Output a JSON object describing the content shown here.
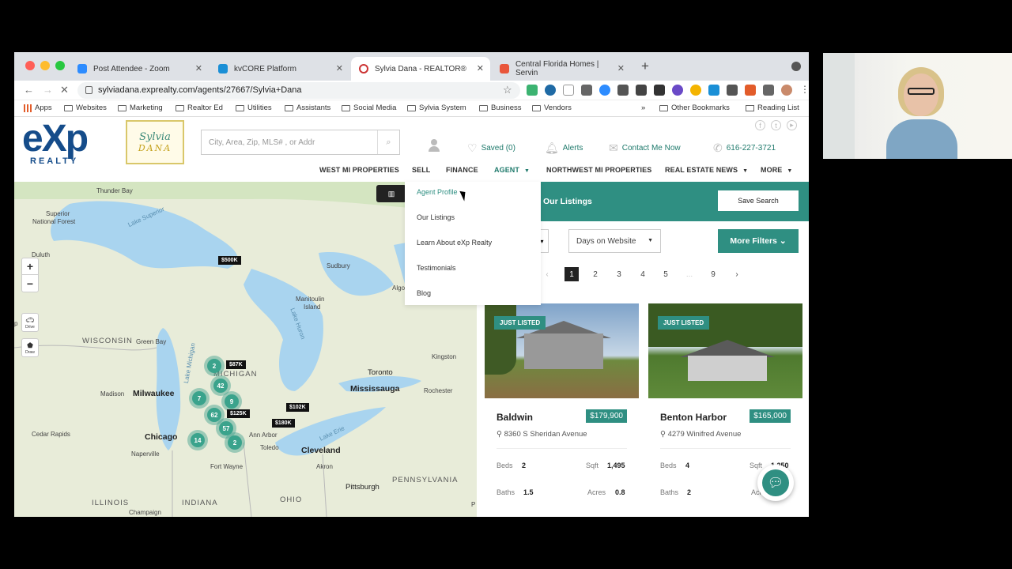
{
  "browser": {
    "tabs": [
      {
        "title": "Post Attendee - Zoom",
        "active": false
      },
      {
        "title": "kvCORE Platform",
        "active": false
      },
      {
        "title": "Sylvia Dana - REALTOR®",
        "active": true
      },
      {
        "title": "Central Florida Homes | Servin",
        "active": false
      }
    ],
    "url": "sylviadana.exprealty.com/agents/27667/Sylvia+Dana",
    "bookmarks": [
      "Apps",
      "Websites",
      "Marketing",
      "Realtor Ed",
      "Utilities",
      "Assistants",
      "Social Media",
      "Sylvia System",
      "Business",
      "Vendors"
    ],
    "other_bookmarks": "Other Bookmarks",
    "reading_list": "Reading List",
    "more_bookmarks": "»"
  },
  "header": {
    "exp_logo_big": "eXp",
    "exp_logo_small": "REALTY",
    "dana_logo_line1": "Sylvia",
    "dana_logo_line2": "DANA",
    "search_placeholder": "City, Area, Zip, MLS# , or Addr",
    "saved": "Saved (0)",
    "alerts": "Alerts",
    "contact": "Contact Me Now",
    "phone": "616-227-3721"
  },
  "nav": {
    "items": [
      "WEST MI PROPERTIES",
      "SELL",
      "FINANCE",
      "AGENT",
      "NORTHWEST MI PROPERTIES",
      "REAL ESTATE NEWS",
      "MORE"
    ]
  },
  "agent_menu": {
    "items": [
      "Agent Profile",
      "Our Listings",
      "Learn About eXp Realty",
      "Testimonials",
      "Blog"
    ]
  },
  "listings_panel": {
    "title_suffix": "r Our Listings",
    "save_search": "Save Search",
    "stub_select_caret": "▾",
    "sort_select": "Days on Website",
    "more_filters": "More Filters",
    "pages": [
      "‹",
      "1",
      "2",
      "3",
      "4",
      "5",
      "...",
      "9",
      "›"
    ],
    "active_page": "1"
  },
  "map": {
    "zoom_in": "+",
    "zoom_out": "−",
    "drive": "Drive",
    "draw": "Draw",
    "labels": {
      "thunder_bay": "Thunder Bay",
      "superior_nf": "Superior",
      "superior_nf2": "National Forest",
      "lake_superior": "Lake Superior",
      "duluth": "Duluth",
      "sudbury": "Sudbury",
      "manitoulin": "Manitoulin",
      "manitoulin2": "Island",
      "algo": "Algo",
      "wisconsin": "WISCONSIN",
      "green_bay": "Green Bay",
      "lake_michigan": "Lake Michigan",
      "lake_huron": "Lake Huron",
      "michigan": "MICHIGAN",
      "toronto": "Toronto",
      "kingston": "Kingston",
      "mississauga": "Mississauga",
      "rochester": "Rochester",
      "madison": "Madison",
      "milwaukee": "Milwaukee",
      "cedar_rapids": "Cedar Rapids",
      "chicago": "Chicago",
      "naperville": "Naperville",
      "ann_arbor": "Ann Arbor",
      "toledo": "Toledo",
      "cleveland": "Cleveland",
      "lake_erie": "Lake Erie",
      "akron": "Akron",
      "fort_wayne": "Fort Wayne",
      "pittsburgh": "Pittsburgh",
      "pennsylvania": "PENNSYLVANIA",
      "illinois": "ILLINOIS",
      "indiana": "INDIANA",
      "ohio": "OHIO",
      "champaign": "Champaign",
      "west_edge": "p",
      "south_edge": "P"
    },
    "clusters": [
      "2",
      "42",
      "7",
      "9",
      "62",
      "57",
      "14",
      "2"
    ],
    "price_tags": [
      "$500K",
      "$87K",
      "$125K",
      "$102K",
      "$180K"
    ]
  },
  "listings": [
    {
      "badge": "JUST LISTED",
      "city": "Baldwin",
      "price": "$179,900",
      "address": "8360 S Sheridan Avenue",
      "beds": "2",
      "sqft": "1,495",
      "baths": "1.5",
      "acres": "0.8"
    },
    {
      "badge": "JUST LISTED",
      "city": "Benton Harbor",
      "price": "$165,000",
      "address": "4279 Winifred Avenue",
      "beds": "4",
      "sqft": "1,250",
      "baths": "2",
      "acres": ""
    }
  ],
  "labels": {
    "beds": "Beds",
    "sqft": "Sqft",
    "baths": "Baths",
    "acres": "Acres"
  },
  "colors": {
    "teal": "#2f8f82",
    "exp_blue": "#154c8a"
  }
}
